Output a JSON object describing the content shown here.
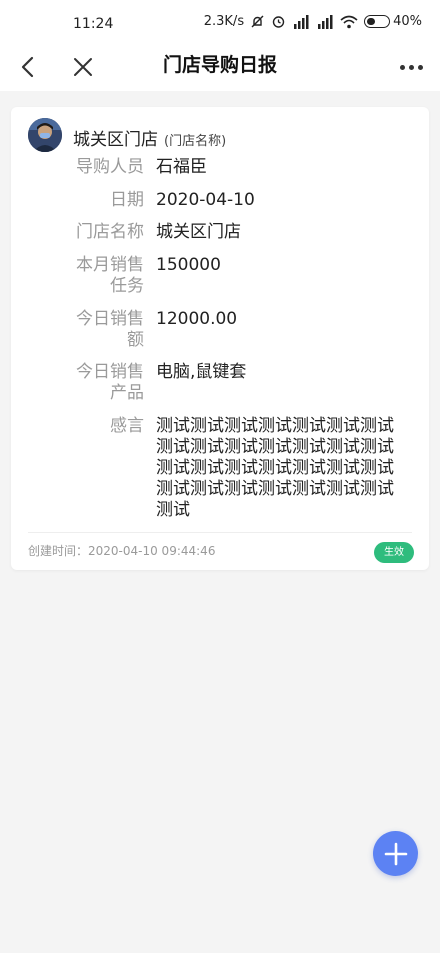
{
  "status_bar": {
    "time": "11:24",
    "net_speed": "2.3K/s",
    "battery_percent": "40%",
    "battery_level": 0.4
  },
  "nav": {
    "title": "门店导购日报",
    "back_icon": "chevron-left-icon",
    "close_icon": "close-icon",
    "more_icon": "more-dots-icon"
  },
  "card": {
    "store_name": "城关区门店",
    "store_name_hint": "(门店名称)",
    "fields": [
      {
        "label": "导购人员",
        "value": "石福臣"
      },
      {
        "label": "日期",
        "value": "2020-04-10"
      },
      {
        "label": "门店名称",
        "value": "城关区门店"
      },
      {
        "label": "本月销售任务",
        "value": "150000"
      },
      {
        "label": "今日销售额",
        "value": "12000.00"
      },
      {
        "label": "今日销售产品",
        "value": "电脑,鼠键套"
      },
      {
        "label": "感言",
        "value": "测试测试测试测试测试测试测试测试测试测试测试测试测试测试测试测试测试测试测试测试测试测试测试测试测试测试测试测试测试"
      }
    ],
    "created_at": "创建时间：2020-04-10 09:44:46",
    "status": "生效",
    "status_color": "#2ebc7d"
  },
  "fab": {
    "icon": "plus-icon",
    "color": "#5c82f3"
  }
}
